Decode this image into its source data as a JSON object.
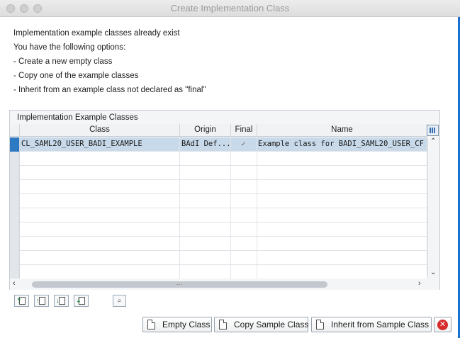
{
  "window": {
    "title": "Create Implementation Class"
  },
  "info": {
    "lines": [
      "Implementation example classes already exist",
      "You have the following options:",
      "- Create a new empty class",
      "- Copy one of the example classes",
      "- Inherit from an example class not declared as \"final\""
    ]
  },
  "table": {
    "title": "Implementation Example Classes",
    "columns": [
      "Class",
      "Origin",
      "Final",
      "Name"
    ],
    "rows": [
      {
        "class": "CL_SAML20_USER_BADI_EXAMPLE",
        "origin": "BAdI Def...",
        "final": "checked",
        "name": "Example class for BADI_SAML20_USER_CF"
      }
    ],
    "empty_rows": 9
  },
  "buttons": {
    "empty_class": "Empty Class",
    "copy_sample": "Copy Sample Class",
    "inherit_sample": "Inherit from Sample Class"
  },
  "icons": {
    "toolbar": [
      "insert-row-icon",
      "append-row-icon",
      "delete-row-icon",
      "move-row-icon",
      "find-icon"
    ],
    "close": "cancel-icon",
    "config": "column-config-icon"
  },
  "colors": {
    "selected_row": "#c8daea",
    "selection_marker": "#2e7ac2",
    "cancel": "#d62b2b"
  }
}
